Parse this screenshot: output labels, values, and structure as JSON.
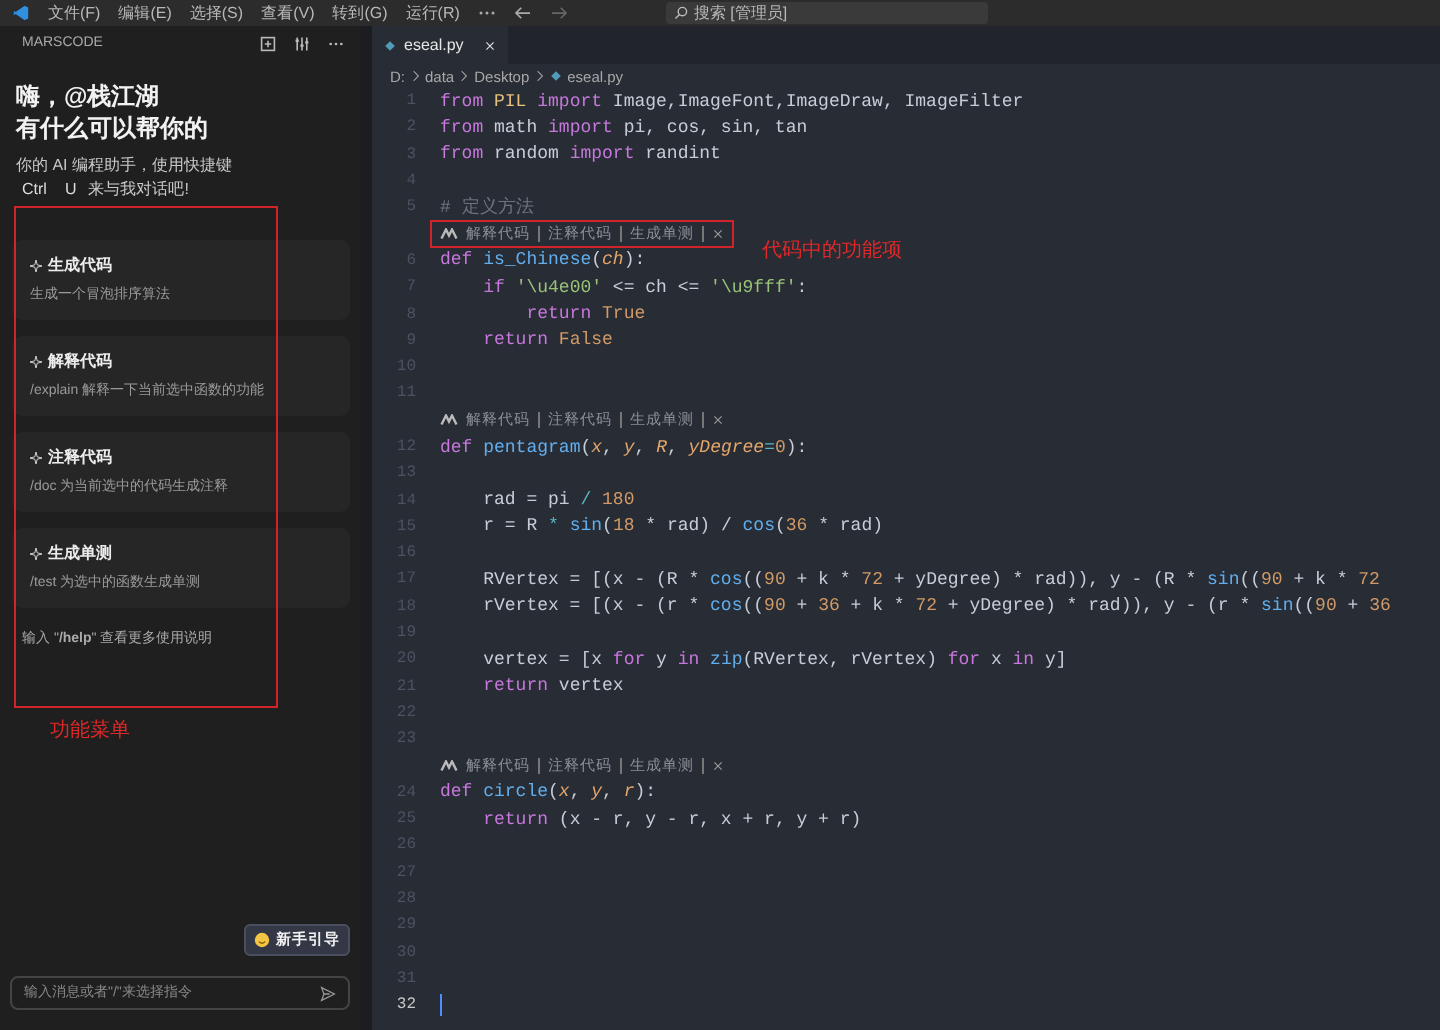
{
  "title_bar": {
    "menus": [
      "文件(F)",
      "编辑(E)",
      "选择(S)",
      "查看(V)",
      "转到(G)",
      "运行(R)"
    ],
    "search": {
      "placeholder": "搜索 [管理员]"
    }
  },
  "sidebar": {
    "title": "MARSCODE",
    "greeting": [
      "嗨，@栈江湖",
      "有什么可以帮你的"
    ],
    "intro": "你的 AI 编程助手，使用快捷键",
    "shortcut": {
      "keys": [
        "Ctrl",
        "U"
      ],
      "text": "来与我对话吧!"
    },
    "menu": {
      "annotation": "功能菜单",
      "cards": [
        {
          "title": "生成代码",
          "description": "生成一个冒泡排序算法"
        },
        {
          "title": "解释代码",
          "description": "/explain 解释一下当前选中函数的功能"
        },
        {
          "title": "注释代码",
          "description": "/doc 为当前选中的代码生成注释"
        },
        {
          "title": "生成单测",
          "description": "/test 为选中的函数生成单测"
        }
      ],
      "help": "输入 \"**/help**\" 查看更多使用说明"
    },
    "guide_button": "新手引导",
    "input": {
      "placeholder": "输入消息或者\"/\"来选择指令"
    }
  },
  "editor": {
    "tabs": [
      {
        "label": "eseal.py",
        "selected": true
      }
    ],
    "breadcrumb": [
      "D:",
      "data",
      "Desktop",
      "eseal.py"
    ],
    "lines": [
      {
        "kind": "code",
        "number": "1",
        "tokens": [
          {
            "text": "from",
            "kind": "kw"
          },
          {
            "text": " PIL ",
            "kind": "cls"
          },
          {
            "text": "import",
            "kind": "kw"
          },
          {
            "text": " Image,ImageFont,ImageDraw, ImageFilter",
            "kind": "plain"
          }
        ]
      },
      {
        "kind": "code",
        "number": "2",
        "tokens": [
          {
            "text": "from",
            "kind": "kw"
          },
          {
            "text": " math ",
            "kind": "plain"
          },
          {
            "text": "import",
            "kind": "kw"
          },
          {
            "text": " pi, cos, sin, tan",
            "kind": "plain"
          }
        ]
      },
      {
        "kind": "code",
        "number": "3",
        "tokens": [
          {
            "text": "from",
            "kind": "kw"
          },
          {
            "text": " random ",
            "kind": "plain"
          },
          {
            "text": "import",
            "kind": "kw"
          },
          {
            "text": " randint",
            "kind": "plain"
          }
        ]
      },
      {
        "kind": "code",
        "number": "4"
      },
      {
        "kind": "code",
        "number": "5",
        "tokens": [
          {
            "text": "# 定义方法",
            "kind": "comment"
          }
        ]
      },
      {
        "kind": "lens",
        "actions": [
          "解释代码",
          "注释代码",
          "生成单测"
        ],
        "highlighted": true,
        "annotation": "代码中的功能项"
      },
      {
        "kind": "code",
        "number": "6",
        "tokens": [
          {
            "text": "def ",
            "kind": "kw"
          },
          {
            "text": "is_Chinese",
            "kind": "fn"
          },
          {
            "text": "(",
            "kind": "plain"
          },
          {
            "text": "ch",
            "kind": "param"
          },
          {
            "text": "):",
            "kind": "plain"
          }
        ]
      },
      {
        "kind": "code",
        "number": "7",
        "tokens": [
          {
            "text": "    if ",
            "kind": "kw"
          },
          {
            "text": "'\\u4e00'",
            "kind": "str"
          },
          {
            "text": " <= ch <= ",
            "kind": "plain"
          },
          {
            "text": "'\\u9fff'",
            "kind": "str"
          },
          {
            "text": ":",
            "kind": "plain"
          }
        ]
      },
      {
        "kind": "code",
        "number": "8",
        "tokens": [
          {
            "text": "        return ",
            "kind": "kw"
          },
          {
            "text": "True",
            "kind": "const"
          }
        ]
      },
      {
        "kind": "code",
        "number": "9",
        "tokens": [
          {
            "text": "    return ",
            "kind": "kw"
          },
          {
            "text": "False",
            "kind": "const"
          }
        ]
      },
      {
        "kind": "code",
        "number": "10"
      },
      {
        "kind": "code",
        "number": "11"
      },
      {
        "kind": "lens",
        "actions": [
          "解释代码",
          "注释代码",
          "生成单测"
        ],
        "highlighted": false
      },
      {
        "kind": "code",
        "number": "12",
        "tokens": [
          {
            "text": "def ",
            "kind": "kw"
          },
          {
            "text": "pentagram",
            "kind": "fn"
          },
          {
            "text": "(",
            "kind": "plain"
          },
          {
            "text": "x",
            "kind": "param"
          },
          {
            "text": ", ",
            "kind": "plain"
          },
          {
            "text": "y",
            "kind": "param"
          },
          {
            "text": ", ",
            "kind": "plain"
          },
          {
            "text": "R",
            "kind": "param"
          },
          {
            "text": ", ",
            "kind": "plain"
          },
          {
            "text": "yDegree",
            "kind": "param"
          },
          {
            "text": "=",
            "kind": "op"
          },
          {
            "text": "0",
            "kind": "num"
          },
          {
            "text": "):",
            "kind": "plain"
          }
        ]
      },
      {
        "kind": "code",
        "number": "13"
      },
      {
        "kind": "code",
        "number": "14",
        "tokens": [
          {
            "text": "    rad = pi ",
            "kind": "plain"
          },
          {
            "text": "/",
            "kind": "op"
          },
          {
            "text": " 180",
            "kind": "num"
          }
        ]
      },
      {
        "kind": "code",
        "number": "15",
        "tokens": [
          {
            "text": "    r = R ",
            "kind": "plain"
          },
          {
            "text": "*",
            "kind": "op"
          },
          {
            "text": " sin",
            "kind": "fn"
          },
          {
            "text": "(",
            "kind": "plain"
          },
          {
            "text": "18",
            "kind": "num"
          },
          {
            "text": " * rad) / ",
            "kind": "plain"
          },
          {
            "text": "cos",
            "kind": "fn"
          },
          {
            "text": "(",
            "kind": "plain"
          },
          {
            "text": "36",
            "kind": "num"
          },
          {
            "text": " * rad)",
            "kind": "plain"
          }
        ]
      },
      {
        "kind": "code",
        "number": "16"
      },
      {
        "kind": "code",
        "number": "17",
        "tokens": [
          {
            "text": "    RVertex = [(x - (R * ",
            "kind": "plain"
          },
          {
            "text": "cos",
            "kind": "fn"
          },
          {
            "text": "((",
            "kind": "plain"
          },
          {
            "text": "90",
            "kind": "num"
          },
          {
            "text": " + k * ",
            "kind": "plain"
          },
          {
            "text": "72",
            "kind": "num"
          },
          {
            "text": " + yDegree) * rad)), y - (R * ",
            "kind": "plain"
          },
          {
            "text": "sin",
            "kind": "fn"
          },
          {
            "text": "((",
            "kind": "plain"
          },
          {
            "text": "90",
            "kind": "num"
          },
          {
            "text": " + k * ",
            "kind": "plain"
          },
          {
            "text": "72",
            "kind": "num"
          }
        ]
      },
      {
        "kind": "code",
        "number": "18",
        "tokens": [
          {
            "text": "    rVertex = [(x - (r * ",
            "kind": "plain"
          },
          {
            "text": "cos",
            "kind": "fn"
          },
          {
            "text": "((",
            "kind": "plain"
          },
          {
            "text": "90",
            "kind": "num"
          },
          {
            "text": " + ",
            "kind": "plain"
          },
          {
            "text": "36",
            "kind": "num"
          },
          {
            "text": " + k * ",
            "kind": "plain"
          },
          {
            "text": "72",
            "kind": "num"
          },
          {
            "text": " + yDegree) * rad)), y - (r * ",
            "kind": "plain"
          },
          {
            "text": "sin",
            "kind": "fn"
          },
          {
            "text": "((",
            "kind": "plain"
          },
          {
            "text": "90",
            "kind": "num"
          },
          {
            "text": " + ",
            "kind": "plain"
          },
          {
            "text": "36",
            "kind": "num"
          }
        ]
      },
      {
        "kind": "code",
        "number": "19"
      },
      {
        "kind": "code",
        "number": "20",
        "tokens": [
          {
            "text": "    vertex = [x ",
            "kind": "plain"
          },
          {
            "text": "for",
            "kind": "kw"
          },
          {
            "text": " y ",
            "kind": "plain"
          },
          {
            "text": "in",
            "kind": "kw"
          },
          {
            "text": " zip",
            "kind": "fn"
          },
          {
            "text": "(RVertex, rVertex) ",
            "kind": "plain"
          },
          {
            "text": "for",
            "kind": "kw"
          },
          {
            "text": " x ",
            "kind": "plain"
          },
          {
            "text": "in",
            "kind": "kw"
          },
          {
            "text": " y]",
            "kind": "plain"
          }
        ]
      },
      {
        "kind": "code",
        "number": "21",
        "tokens": [
          {
            "text": "    return ",
            "kind": "kw"
          },
          {
            "text": "vertex",
            "kind": "plain"
          }
        ]
      },
      {
        "kind": "code",
        "number": "22"
      },
      {
        "kind": "code",
        "number": "23"
      },
      {
        "kind": "lens",
        "actions": [
          "解释代码",
          "注释代码",
          "生成单测"
        ],
        "highlighted": false
      },
      {
        "kind": "code",
        "number": "24",
        "tokens": [
          {
            "text": "def ",
            "kind": "kw"
          },
          {
            "text": "circle",
            "kind": "fn"
          },
          {
            "text": "(",
            "kind": "plain"
          },
          {
            "text": "x",
            "kind": "param"
          },
          {
            "text": ", ",
            "kind": "plain"
          },
          {
            "text": "y",
            "kind": "param"
          },
          {
            "text": ", ",
            "kind": "plain"
          },
          {
            "text": "r",
            "kind": "param"
          },
          {
            "text": "):",
            "kind": "plain"
          }
        ]
      },
      {
        "kind": "code",
        "number": "25",
        "tokens": [
          {
            "text": "    return ",
            "kind": "kw"
          },
          {
            "text": "(x - r, y - r, x + r, y + r)",
            "kind": "plain"
          }
        ]
      },
      {
        "kind": "code",
        "number": "26"
      },
      {
        "kind": "code",
        "number": "27"
      },
      {
        "kind": "code",
        "number": "28"
      },
      {
        "kind": "code",
        "number": "29"
      },
      {
        "kind": "code",
        "number": "30"
      },
      {
        "kind": "code",
        "number": "31"
      },
      {
        "kind": "code",
        "number": "32",
        "active": true
      }
    ]
  }
}
